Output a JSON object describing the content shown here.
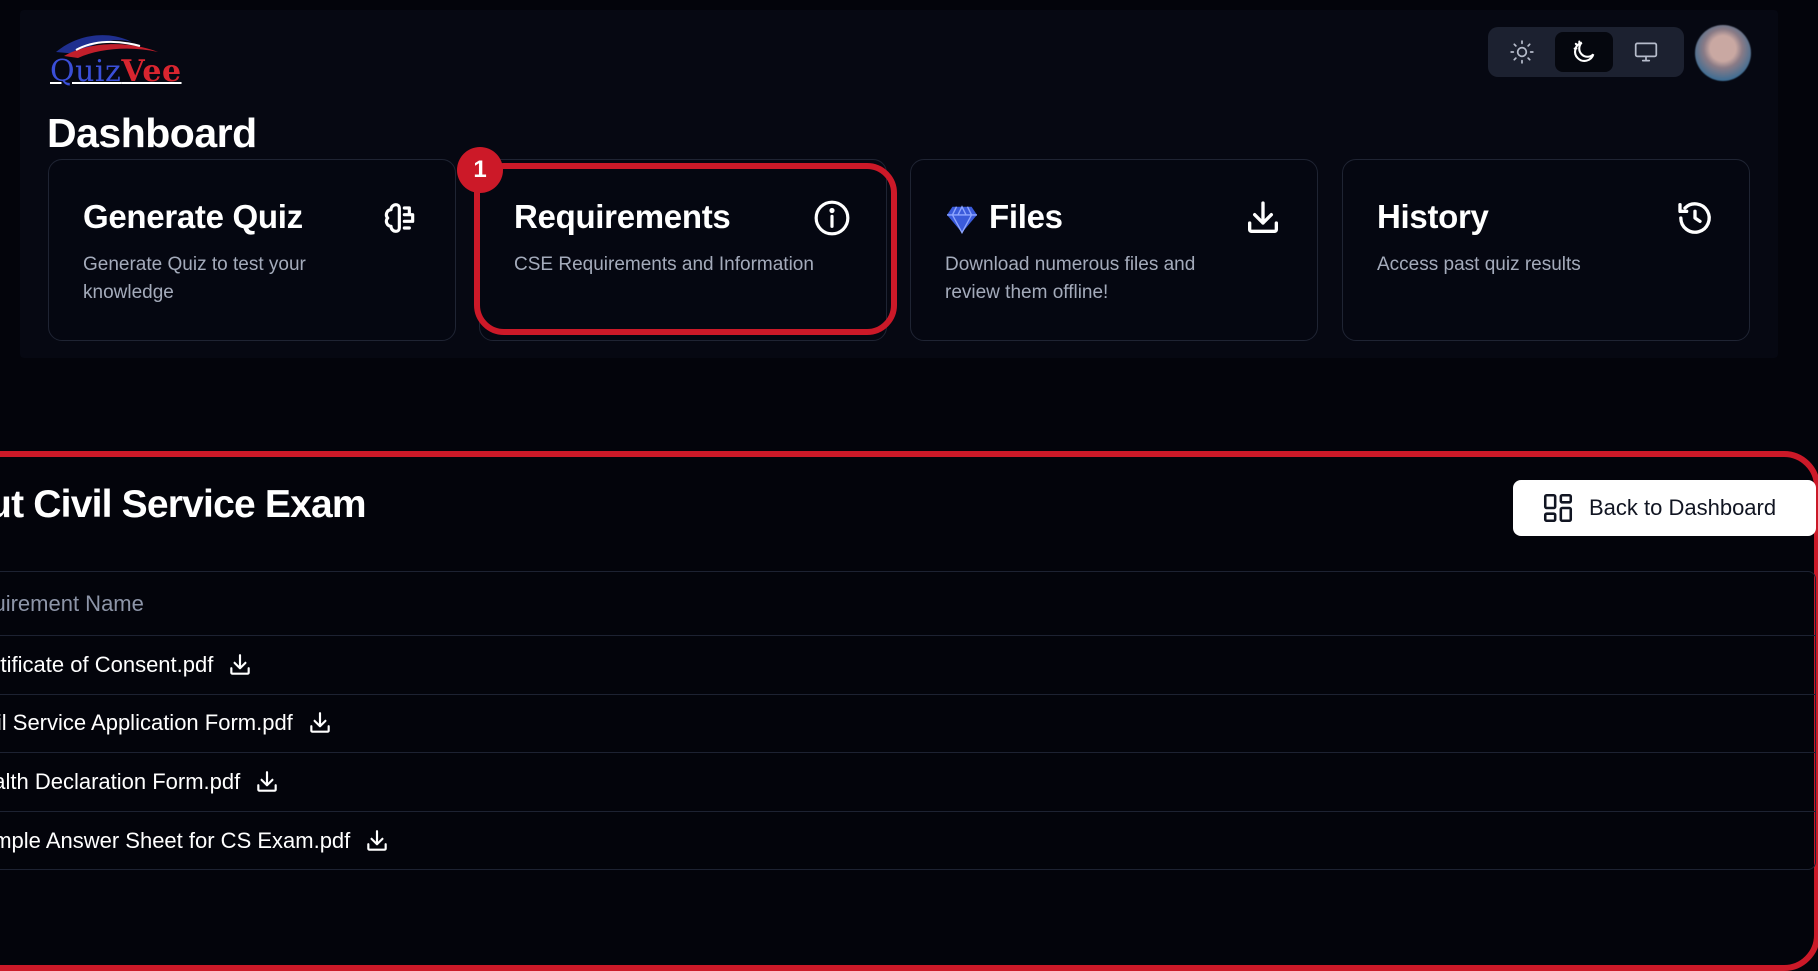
{
  "logo": {
    "part1": "Quiz",
    "part2": "Vee"
  },
  "page_title": "Dashboard",
  "theme_switcher": {
    "options": [
      "light",
      "dark",
      "system"
    ],
    "selected": "dark"
  },
  "cards": [
    {
      "title": "Generate Quiz",
      "description": "Generate Quiz to test your knowledge",
      "icon": "brain-icon"
    },
    {
      "title": "Requirements",
      "description": "CSE Requirements and Information",
      "icon": "info-icon"
    },
    {
      "title": "Files",
      "description": "Download numerous files and review them offline!",
      "icon": "download-icon",
      "badge_icon": "gem-icon"
    },
    {
      "title": "History",
      "description": "Access past quiz results",
      "icon": "history-icon"
    }
  ],
  "annotation": {
    "badge_number": "1"
  },
  "section": {
    "title": "bout Civil Service Exam",
    "back_button_label": "Back to Dashboard"
  },
  "table": {
    "header": "equirement Name",
    "rows": [
      {
        "name": "ertificate of Consent.pdf"
      },
      {
        "name": "ivil Service Application Form.pdf"
      },
      {
        "name": "ealth Declaration Form.pdf"
      },
      {
        "name": "ample Answer Sheet for CS Exam.pdf"
      }
    ]
  },
  "colors": {
    "background": "#03040b",
    "panel": "#060812",
    "accent_red": "#cc1928",
    "logo_blue": "#3a4fd8",
    "logo_red": "#d8252f",
    "gem_blue": "#3b5bdb"
  }
}
